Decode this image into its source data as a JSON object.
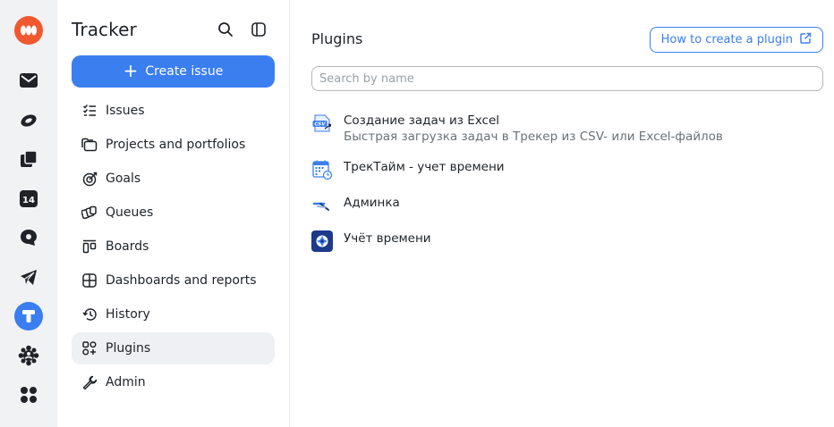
{
  "rail": {
    "items": [
      {
        "name": "app-logo-icon"
      },
      {
        "name": "mail-icon"
      },
      {
        "name": "disk-icon"
      },
      {
        "name": "docs-icon"
      },
      {
        "name": "calendar-icon",
        "label": "14"
      },
      {
        "name": "messenger-icon"
      },
      {
        "name": "telegram-icon"
      },
      {
        "name": "tracker-icon"
      },
      {
        "name": "team-icon"
      },
      {
        "name": "all-apps-icon"
      }
    ]
  },
  "sidebar": {
    "title": "Tracker",
    "create_label": "Create issue",
    "nav": [
      {
        "label": "Issues",
        "icon": "issues-icon"
      },
      {
        "label": "Projects and portfolios",
        "icon": "projects-icon"
      },
      {
        "label": "Goals",
        "icon": "goals-icon"
      },
      {
        "label": "Queues",
        "icon": "queues-icon"
      },
      {
        "label": "Boards",
        "icon": "boards-icon"
      },
      {
        "label": "Dashboards and reports",
        "icon": "dashboards-icon"
      },
      {
        "label": "History",
        "icon": "history-icon"
      },
      {
        "label": "Plugins",
        "icon": "plugins-icon",
        "active": true
      },
      {
        "label": "Admin",
        "icon": "admin-wrench-icon"
      }
    ]
  },
  "main": {
    "title": "Plugins",
    "help_link": "How to create a plugin",
    "search_placeholder": "Search by name",
    "plugins": [
      {
        "name": "Создание задач из Excel",
        "description": "Быстрая загрузка задач в Трекер из CSV- или Excel-файлов",
        "icon": "csv-icon"
      },
      {
        "name": "ТрекТайм - учет времени",
        "description": "",
        "icon": "calendar-clock-icon"
      },
      {
        "name": "Админка",
        "description": "",
        "icon": "admin-plugin-icon"
      },
      {
        "name": "Учёт времени",
        "description": "",
        "icon": "time-tracking-icon"
      }
    ]
  },
  "colors": {
    "accent": "#3a7ef0",
    "logo": "#f0582f",
    "rail_bg": "#f1f2f4",
    "active_bg": "#eef0f3"
  }
}
